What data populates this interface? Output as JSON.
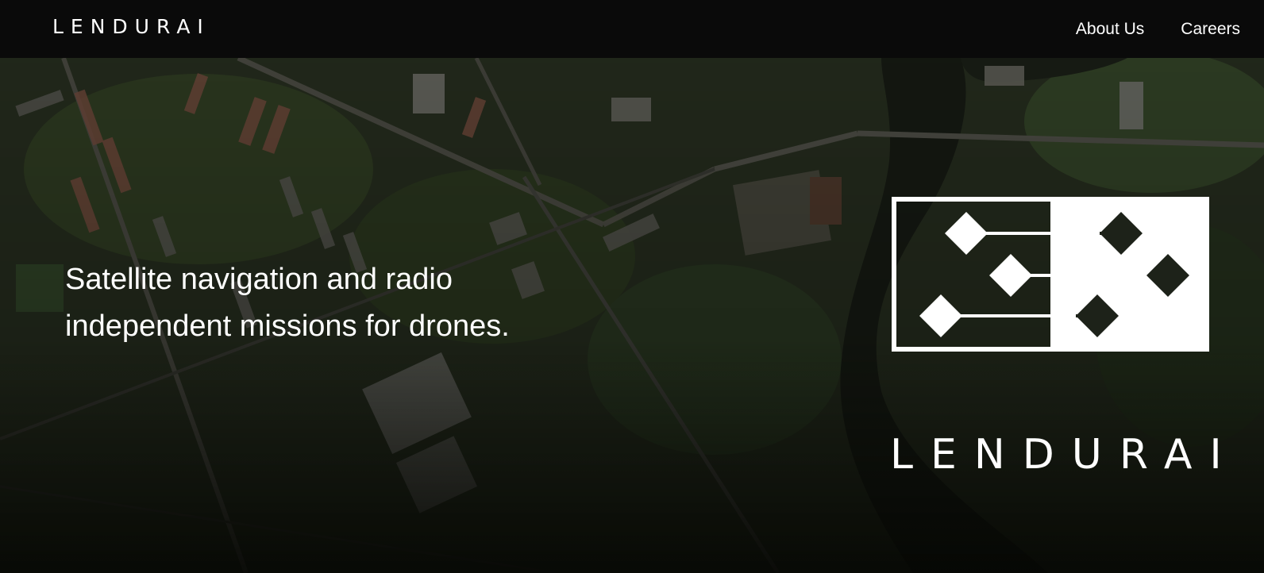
{
  "header": {
    "brand": "LENDURAI",
    "nav": [
      {
        "label": "About Us"
      },
      {
        "label": "Careers"
      }
    ]
  },
  "hero": {
    "tagline_line1": "Satellite navigation and radio",
    "tagline_line2": "independent missions for drones.",
    "logo_wordmark": "LENDURAI",
    "background": "aerial-satellite-city-image"
  },
  "colors": {
    "nav_bg": "#0a0a0a",
    "text": "#ffffff",
    "logo": "#ffffff"
  }
}
